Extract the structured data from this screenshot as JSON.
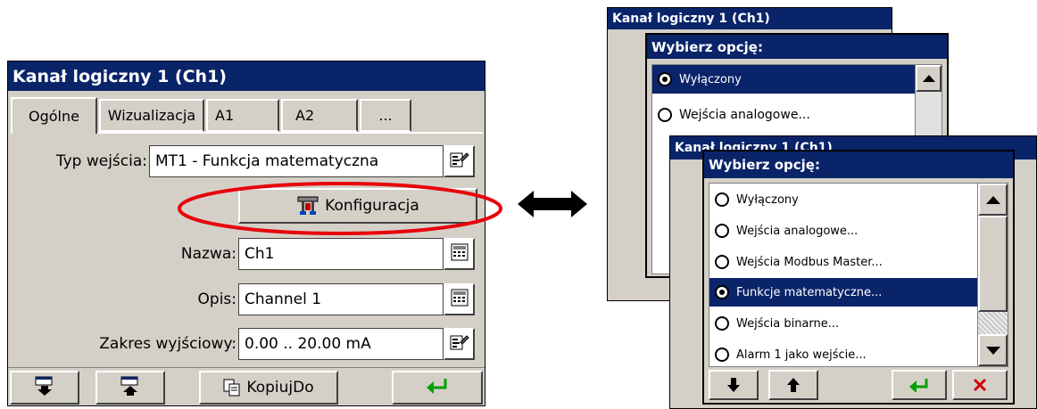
{
  "left_window": {
    "title": "Kanał logiczny 1 (Ch1)",
    "tabs": [
      "Ogólne",
      "Wizualizacja",
      "A1",
      "A2",
      "..."
    ],
    "input_type_label": "Typ wejścia:",
    "input_type_value": "MT1 - Funkcja matematyczna",
    "config_button_label": "Konfiguracja",
    "name_label": "Nazwa:",
    "name_value": "Ch1",
    "description_label": "Opis:",
    "description_value": "Channel 1",
    "output_range_label": "Zakres wyjściowy:",
    "output_range_value": "0.00 .. 20.00 mA",
    "copy_button_label": "KopiujDo"
  },
  "back_dialog": {
    "parent_title": "Kanał logiczny 1 (Ch1)",
    "title": "Wybierz opcję:",
    "options": [
      {
        "label": "Wyłączony",
        "selected": true
      },
      {
        "label": "Wejścia analogowe...",
        "selected": false
      }
    ]
  },
  "front_dialog": {
    "parent_title": "Kanał logiczny 1 (Ch1)",
    "title": "Wybierz opcję:",
    "options": [
      {
        "label": "Wyłączony",
        "selected": false
      },
      {
        "label": "Wejścia analogowe...",
        "selected": false
      },
      {
        "label": "Wejścia Modbus Master...",
        "selected": false
      },
      {
        "label": "Funkcje matematyczne...",
        "selected": true
      },
      {
        "label": "Wejścia binarne...",
        "selected": false
      },
      {
        "label": "Alarm 1 jako wejście...",
        "selected": false
      }
    ]
  },
  "colors": {
    "title_bar": "#0a246a",
    "window_face": "#d4d0c8",
    "highlight_ellipse": "#e8000a",
    "cancel_x": "#d40000",
    "enter_arrow": "#00a000"
  },
  "icons": [
    "properties-icon",
    "calculator-icon",
    "config-tool-icon",
    "copy-icon",
    "enter-icon",
    "cancel-x-icon",
    "double-arrow-icon"
  ]
}
